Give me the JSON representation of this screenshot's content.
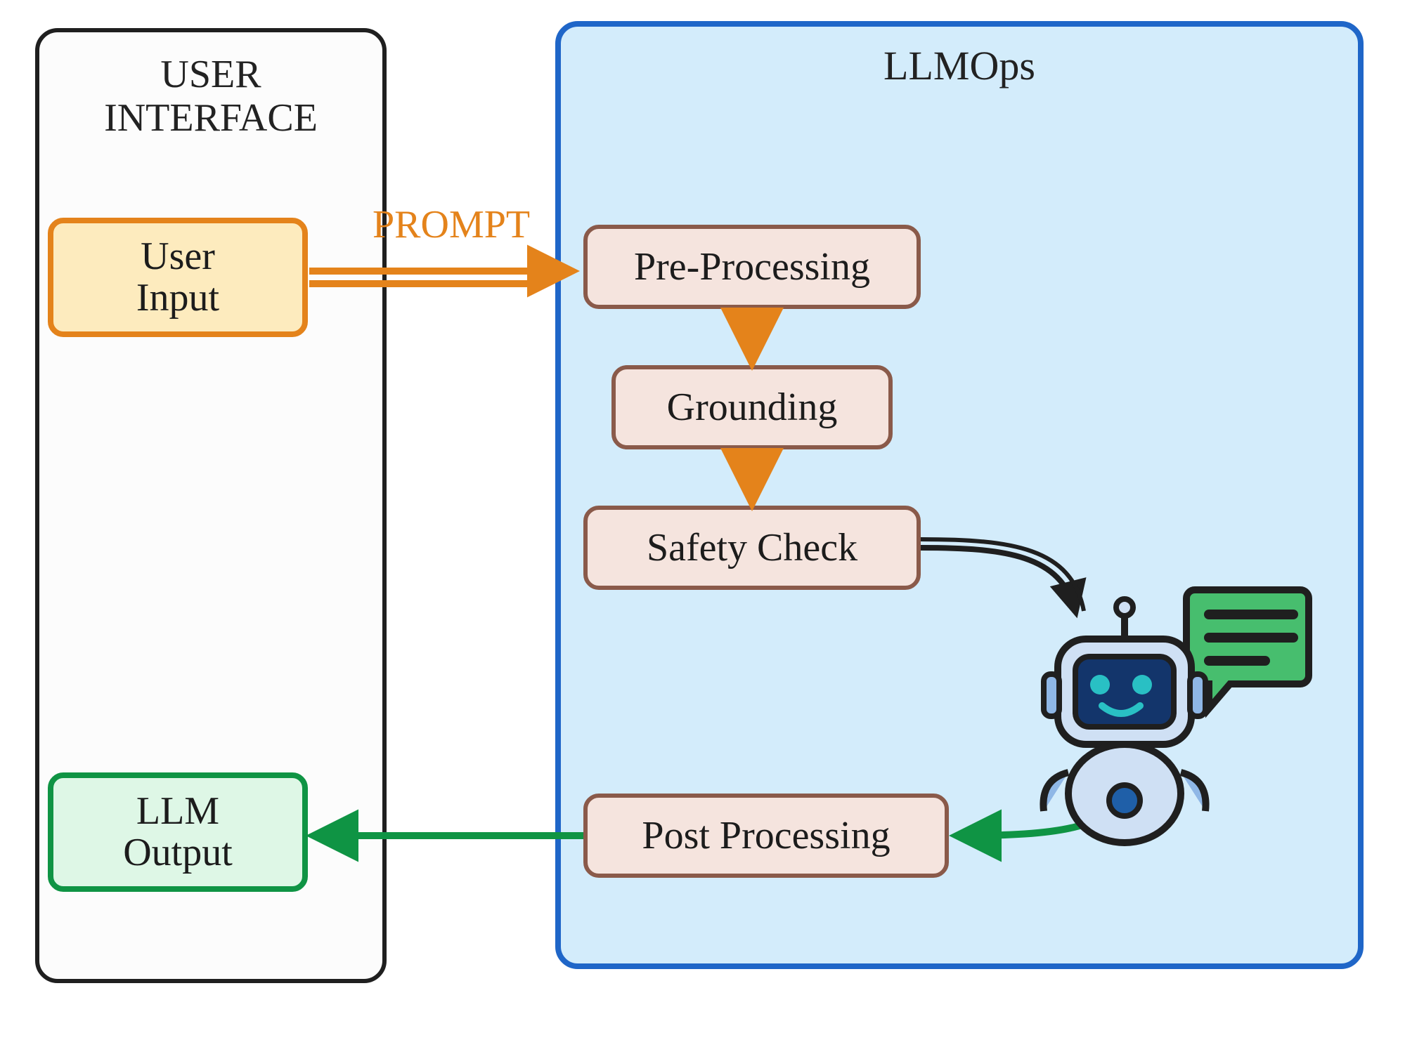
{
  "panels": {
    "user_interface": {
      "title": "USER\nINTERFACE"
    },
    "llmops": {
      "title": "LLMOps"
    }
  },
  "nodes": {
    "user_input": {
      "label": "User\nInput"
    },
    "llm_output": {
      "label": "LLM\nOutput"
    }
  },
  "steps": {
    "pre_processing": {
      "label": "Pre-Processing"
    },
    "grounding": {
      "label": "Grounding"
    },
    "safety_check": {
      "label": "Safety Check"
    },
    "post_processing": {
      "label": "Post Processing"
    }
  },
  "edges": {
    "prompt": {
      "label": "PROMPT"
    }
  },
  "icons": {
    "robot": "robot-chat-icon"
  },
  "colors": {
    "orange": "#e4831b",
    "green": "#0f9444",
    "blue": "#1f66c8",
    "ink": "#1f1f1f",
    "step_fill": "#f5e4de",
    "step_border": "#8a5a4a"
  }
}
